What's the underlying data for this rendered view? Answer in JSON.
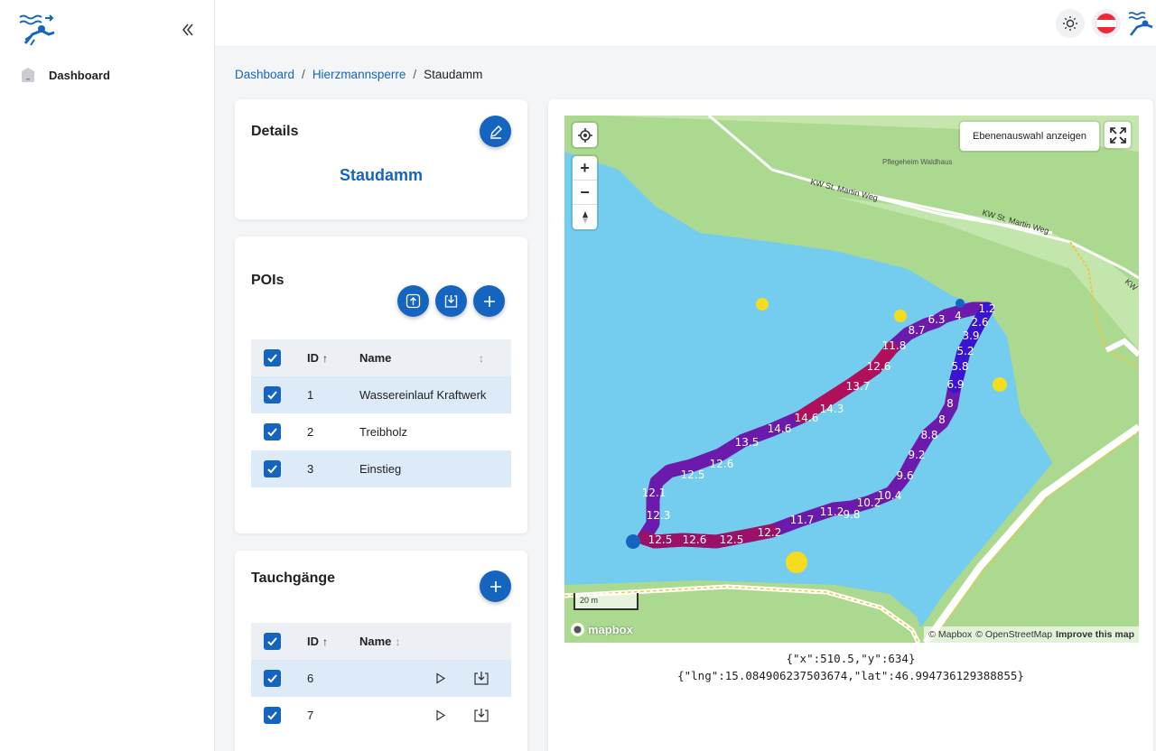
{
  "sidebar": {
    "items": [
      {
        "label": "Dashboard"
      }
    ]
  },
  "breadcrumb": {
    "items": [
      "Dashboard",
      "Hierzmannsperre"
    ],
    "current": "Staudamm"
  },
  "details": {
    "title": "Details",
    "name": "Staudamm"
  },
  "pois": {
    "title": "POIs",
    "columns": {
      "id": "ID",
      "name": "Name"
    },
    "rows": [
      {
        "id": "1",
        "name": "Wassereinlauf Kraftwerk"
      },
      {
        "id": "2",
        "name": "Treibholz"
      },
      {
        "id": "3",
        "name": "Einstieg"
      }
    ]
  },
  "dives": {
    "title": "Tauchgänge",
    "columns": {
      "id": "ID",
      "name": "Name"
    },
    "rows": [
      {
        "id": "6",
        "name": ""
      },
      {
        "id": "7",
        "name": ""
      }
    ]
  },
  "map": {
    "layer_button": "Ebenenauswahl anzeigen",
    "scale": "20 m",
    "logo": "mapbox",
    "attribution": [
      "© Mapbox",
      "© OpenStreetMap",
      "Improve this map"
    ],
    "labels": [
      "Pflegeheim Waldhaus",
      "KW St. Martin Weg",
      "KW St. Martin Weg",
      "KW"
    ],
    "depth_labels": [
      "1.2",
      "2.6",
      "3.9",
      "5.2",
      "5.8",
      "6.9",
      "8",
      "8",
      "8.8",
      "9.2",
      "9.6",
      "10.4",
      "10.2",
      "9.8",
      "11.2",
      "11.7",
      "12.2",
      "12.5",
      "12.6",
      "12.5",
      "12.3",
      "12.1",
      "12.5",
      "12.6",
      "13.5",
      "14.6",
      "14.6",
      "14.3",
      "13.7",
      "12.6",
      "11.8",
      "8.7",
      "6.3",
      "4"
    ],
    "colors": {
      "water": "#74cdef",
      "land": "#a9d88e",
      "track_shallow": "#2a12e0",
      "track_deep": "#b0105a",
      "poi": "#f5dc1e"
    }
  },
  "coordinates": {
    "pixel": "{\"x\":510.5,\"y\":634}",
    "geo": "{\"lng\":15.084906237503674,\"lat\":46.994736129388855}"
  }
}
